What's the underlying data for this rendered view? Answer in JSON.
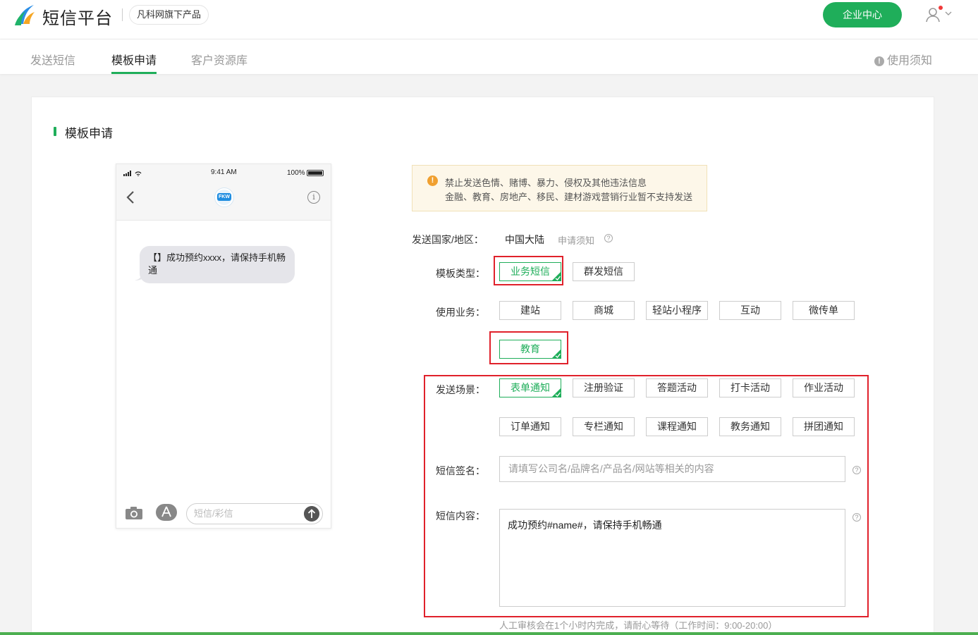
{
  "header": {
    "logo_text": "短信平台",
    "brand_badge": "凡科网旗下产品",
    "enterprise_button": "企业中心"
  },
  "nav": {
    "tabs": [
      {
        "label": "发送短信",
        "active": false
      },
      {
        "label": "模板申请",
        "active": true
      },
      {
        "label": "客户资源库",
        "active": false
      }
    ],
    "notice_link": "使用须知"
  },
  "card": {
    "title": "模板申请"
  },
  "phone": {
    "time": "9:41 AM",
    "battery": "100%",
    "avatar_text": "FKW",
    "message": "【】成功预约xxxx，请保持手机畅通",
    "input_placeholder": "短信/彩信"
  },
  "warning": {
    "line1": "禁止发送色情、赌博、暴力、侵权及其他违法信息",
    "line2": "金融、教育、房地产、移民、建材游戏营销行业暂不支持发送"
  },
  "form": {
    "country_label": "发送国家/地区：",
    "country_value": "中国大陆",
    "apply_notice": "申请须知",
    "type_label": "模板类型：",
    "types": [
      {
        "label": "业务短信",
        "selected": true
      },
      {
        "label": "群发短信",
        "selected": false
      }
    ],
    "business_label": "使用业务：",
    "businesses": [
      {
        "label": "建站",
        "selected": false
      },
      {
        "label": "商城",
        "selected": false
      },
      {
        "label": "轻站小程序",
        "selected": false
      },
      {
        "label": "互动",
        "selected": false
      },
      {
        "label": "微传单",
        "selected": false
      },
      {
        "label": "教育",
        "selected": true
      }
    ],
    "scene_label": "发送场景：",
    "scenes": [
      {
        "label": "表单通知",
        "selected": true
      },
      {
        "label": "注册验证",
        "selected": false
      },
      {
        "label": "答题活动",
        "selected": false
      },
      {
        "label": "打卡活动",
        "selected": false
      },
      {
        "label": "作业活动",
        "selected": false
      },
      {
        "label": "订单通知",
        "selected": false
      },
      {
        "label": "专栏通知",
        "selected": false
      },
      {
        "label": "课程通知",
        "selected": false
      },
      {
        "label": "教务通知",
        "selected": false
      },
      {
        "label": "拼团通知",
        "selected": false
      }
    ],
    "signature_label": "短信签名：",
    "signature_placeholder": "请填写公司名/品牌名/产品名/网站等相关的内容",
    "content_label": "短信内容：",
    "content_value": "成功预约#name#，请保持手机畅通",
    "review_hint": "人工审核会在1个小时内完成，请耐心等待（工作时间：9:00-20:00）"
  },
  "colors": {
    "accent": "#1fae5a",
    "highlight_red": "#e0212b",
    "warning_bg": "#fdf7e9"
  }
}
